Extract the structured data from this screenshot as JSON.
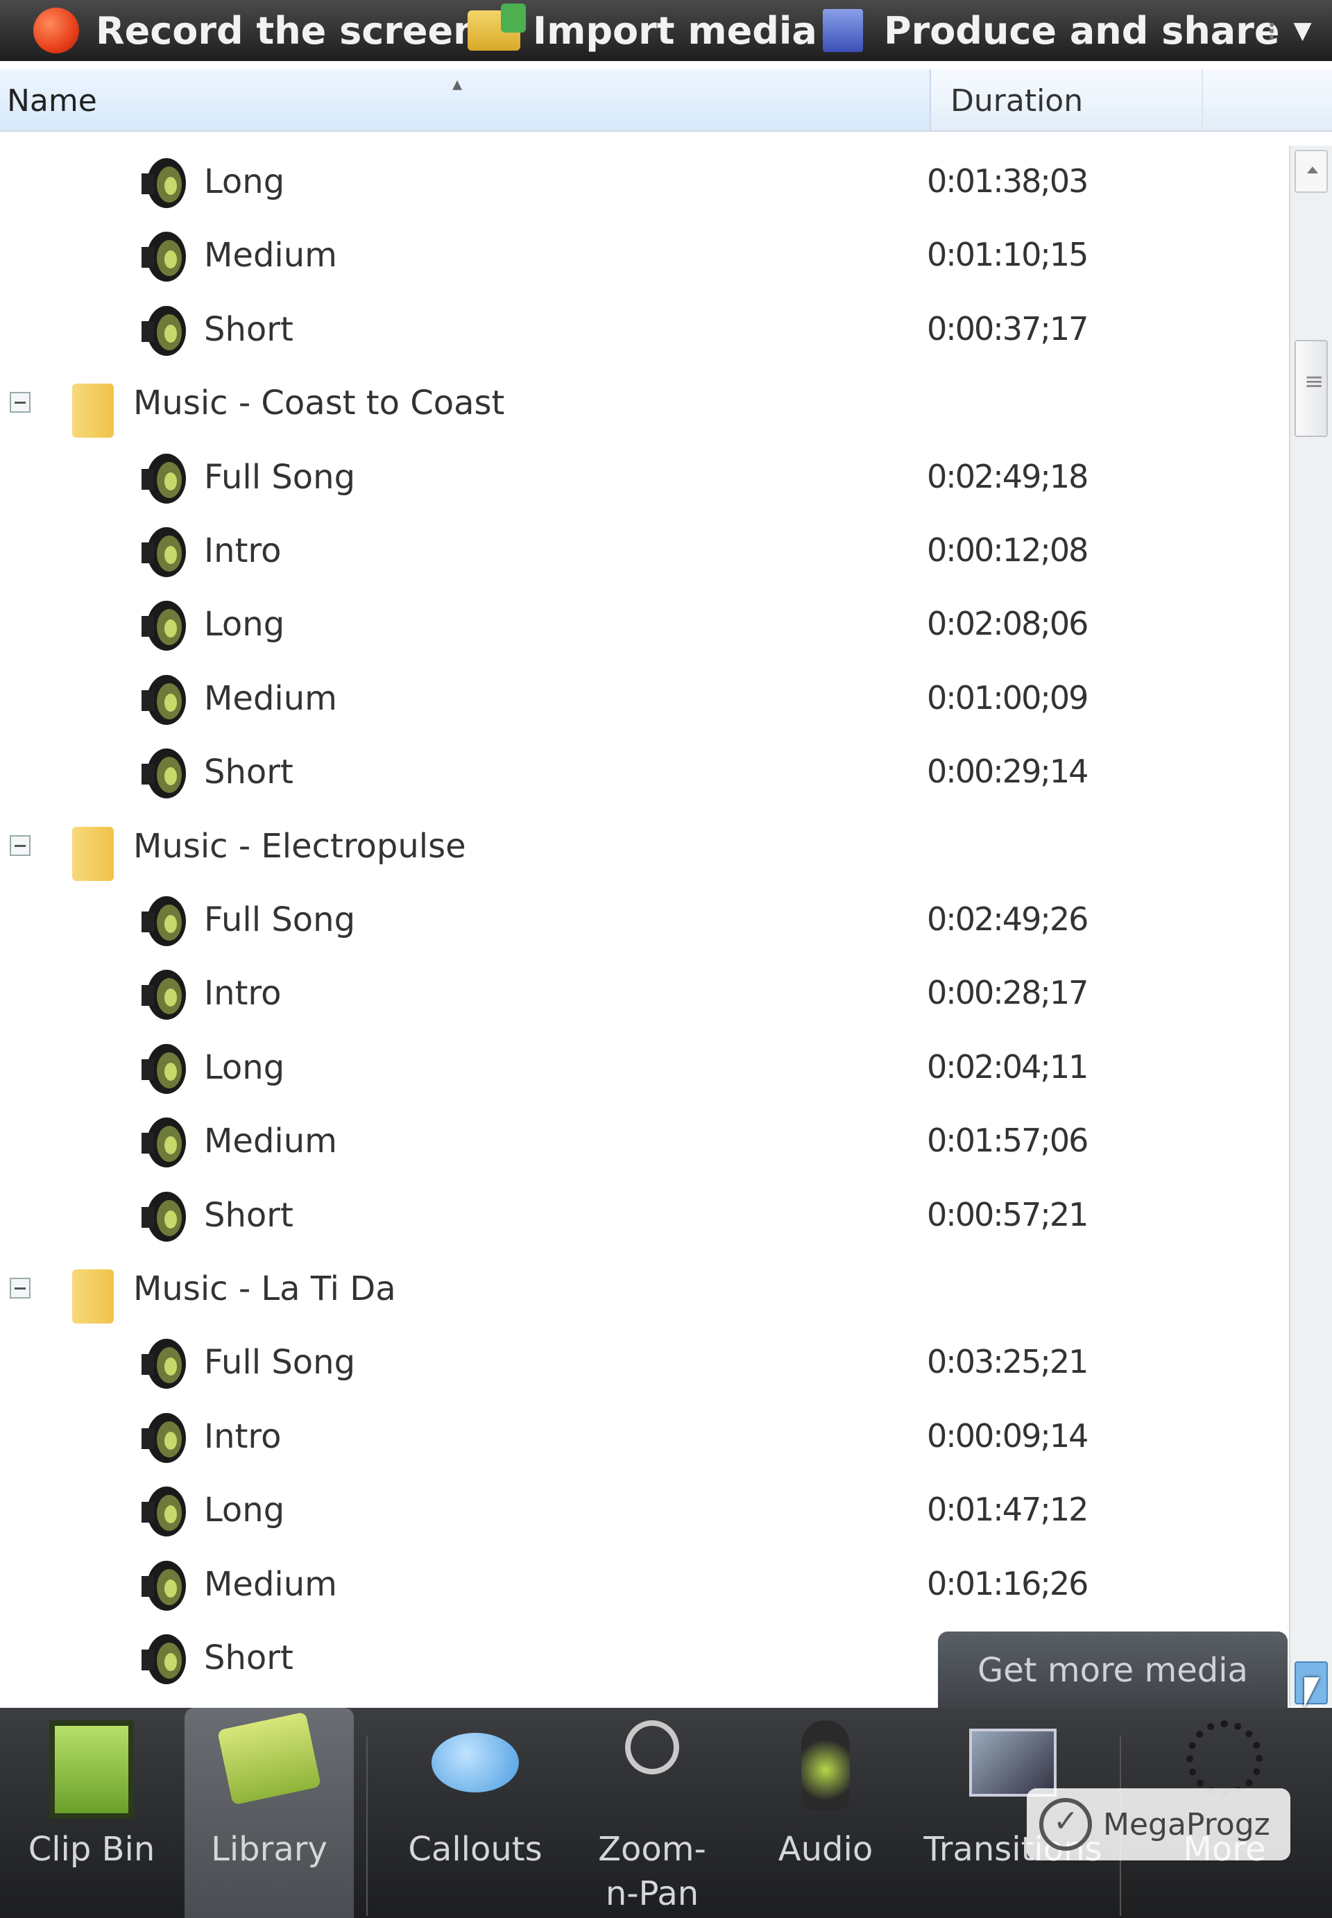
{
  "toolbar": {
    "record_label": "Record the screen",
    "import_label": "Import media",
    "produce_label": "Produce and share"
  },
  "header": {
    "name_label": "Name",
    "duration_label": "Duration"
  },
  "rows": [
    {
      "type": "clip",
      "name": "Long",
      "duration": "0:01:38;03"
    },
    {
      "type": "clip",
      "name": "Medium",
      "duration": "0:01:10;15"
    },
    {
      "type": "clip",
      "name": "Short",
      "duration": "0:00:37;17"
    },
    {
      "type": "folder",
      "name": "Music - Coast to Coast"
    },
    {
      "type": "clip",
      "name": "Full Song",
      "duration": "0:02:49;18"
    },
    {
      "type": "clip",
      "name": "Intro",
      "duration": "0:00:12;08"
    },
    {
      "type": "clip",
      "name": "Long",
      "duration": "0:02:08;06"
    },
    {
      "type": "clip",
      "name": "Medium",
      "duration": "0:01:00;09"
    },
    {
      "type": "clip",
      "name": "Short",
      "duration": "0:00:29;14"
    },
    {
      "type": "folder",
      "name": "Music - Electropulse"
    },
    {
      "type": "clip",
      "name": "Full Song",
      "duration": "0:02:49;26"
    },
    {
      "type": "clip",
      "name": "Intro",
      "duration": "0:00:28;17"
    },
    {
      "type": "clip",
      "name": "Long",
      "duration": "0:02:04;11"
    },
    {
      "type": "clip",
      "name": "Medium",
      "duration": "0:01:57;06"
    },
    {
      "type": "clip",
      "name": "Short",
      "duration": "0:00:57;21"
    },
    {
      "type": "folder",
      "name": "Music - La Ti Da"
    },
    {
      "type": "clip",
      "name": "Full Song",
      "duration": "0:03:25;21"
    },
    {
      "type": "clip",
      "name": "Intro",
      "duration": "0:00:09;14"
    },
    {
      "type": "clip",
      "name": "Long",
      "duration": "0:01:47;12"
    },
    {
      "type": "clip",
      "name": "Medium",
      "duration": "0:01:16;26"
    },
    {
      "type": "clip",
      "name": "Short",
      "duration": ""
    }
  ],
  "get_more_media_label": "Get more media",
  "tabs": [
    {
      "label": "Clip Bin",
      "icon": "film-icon"
    },
    {
      "label": "Library",
      "icon": "library-icon",
      "active": true
    },
    {
      "label": "Callouts",
      "icon": "callout-icon"
    },
    {
      "label": "Zoom-n-Pan",
      "icon": "zoom-icon"
    },
    {
      "label": "Audio",
      "icon": "audio-icon"
    },
    {
      "label": "Transitions",
      "icon": "transitions-icon"
    },
    {
      "label": "More",
      "icon": "more-icon"
    }
  ],
  "watermark_label": "MegaProgz",
  "colors": {
    "toolbar_bg": "#2a2a2a",
    "header_bg": "#e3eef9",
    "tabbar_bg": "#2b2c2e",
    "accent": "#7ab6e8"
  }
}
